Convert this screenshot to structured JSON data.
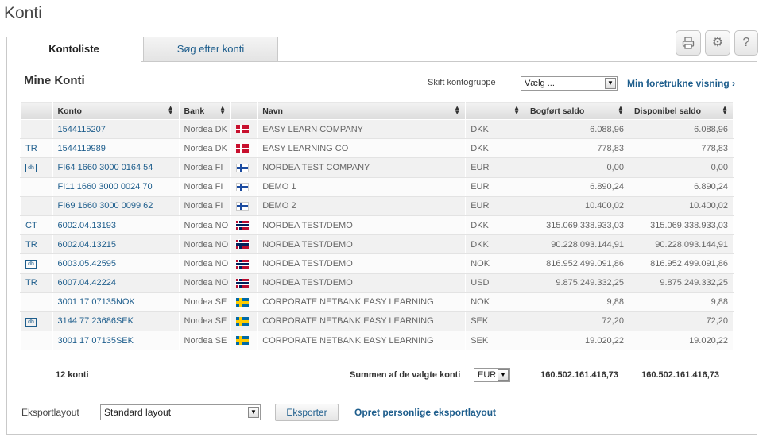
{
  "page": {
    "title": "Konti"
  },
  "tabs": [
    {
      "label": "Kontoliste",
      "active": true
    },
    {
      "label": "Søg efter konti",
      "active": false
    }
  ],
  "toolbar": {
    "icons": [
      "printer-icon",
      "gear-icon",
      "help-icon"
    ],
    "help_label": "?"
  },
  "section": {
    "title": "Mine Konti"
  },
  "group": {
    "label": "Skift kontogruppe",
    "selected": "Vælg ..."
  },
  "favorite_link": "Min foretrukne visning ›",
  "table": {
    "headers": [
      "Konto",
      "Bank",
      "Navn",
      "Bogført saldo",
      "Disponibel saldo"
    ],
    "rows": [
      {
        "type": "",
        "account": "1544115207",
        "bank": "Nordea DK",
        "flag": "dk",
        "name": "EASY LEARN COMPANY",
        "currency": "DKK",
        "booked": "6.088,96",
        "available": "6.088,96"
      },
      {
        "type": "TR",
        "account": "1544119989",
        "bank": "Nordea DK",
        "flag": "dk",
        "name": "EASY LEARNING CO",
        "currency": "DKK",
        "booked": "778,83",
        "available": "778,83"
      },
      {
        "type": "icon",
        "account": "FI64 1660 3000 0164 54",
        "bank": "Nordea FI",
        "flag": "fi",
        "name": "NORDEA TEST COMPANY",
        "currency": "EUR",
        "booked": "0,00",
        "available": "0,00"
      },
      {
        "type": "",
        "account": "FI11 1660 3000 0024 70",
        "bank": "Nordea FI",
        "flag": "fi",
        "name": "DEMO 1",
        "currency": "EUR",
        "booked": "6.890,24",
        "available": "6.890,24"
      },
      {
        "type": "",
        "account": "FI69 1660 3000 0099 62",
        "bank": "Nordea FI",
        "flag": "fi",
        "name": "DEMO 2",
        "currency": "EUR",
        "booked": "10.400,02",
        "available": "10.400,02"
      },
      {
        "type": "CT",
        "account": "6002.04.13193",
        "bank": "Nordea NO",
        "flag": "no",
        "name": "NORDEA TEST/DEMO",
        "currency": "DKK",
        "booked": "315.069.338.933,03",
        "available": "315.069.338.933,03"
      },
      {
        "type": "TR",
        "account": "6002.04.13215",
        "bank": "Nordea NO",
        "flag": "no",
        "name": "NORDEA TEST/DEMO",
        "currency": "DKK",
        "booked": "90.228.093.144,91",
        "available": "90.228.093.144,91"
      },
      {
        "type": "icon",
        "account": "6003.05.42595",
        "bank": "Nordea NO",
        "flag": "no",
        "name": "NORDEA TEST/DEMO",
        "currency": "NOK",
        "booked": "816.952.499.091,86",
        "available": "816.952.499.091,86"
      },
      {
        "type": "TR",
        "account": "6007.04.42224",
        "bank": "Nordea NO",
        "flag": "no",
        "name": "NORDEA TEST/DEMO",
        "currency": "USD",
        "booked": "9.875.249.332,25",
        "available": "9.875.249.332,25"
      },
      {
        "type": "",
        "account": "3001 17 07135NOK",
        "bank": "Nordea SE",
        "flag": "se",
        "name": "CORPORATE NETBANK EASY LEARNING",
        "currency": "NOK",
        "booked": "9,88",
        "available": "9,88"
      },
      {
        "type": "icon",
        "account": "3144 77 23686SEK",
        "bank": "Nordea SE",
        "flag": "se",
        "name": "CORPORATE NETBANK EASY LEARNING",
        "currency": "SEK",
        "booked": "72,20",
        "available": "72,20"
      },
      {
        "type": "",
        "account": "3001 17 07135SEK",
        "bank": "Nordea SE",
        "flag": "se",
        "name": "CORPORATE NETBANK EASY LEARNING",
        "currency": "SEK",
        "booked": "19.020,22",
        "available": "19.020,22"
      }
    ]
  },
  "summary": {
    "count": "12 konti",
    "label": "Summen af de valgte konti",
    "currency": "EUR",
    "booked_total": "160.502.161.416,73",
    "available_total": "160.502.161.416,73"
  },
  "export": {
    "label": "Eksportlayout",
    "selected": "Standard layout",
    "button": "Eksporter",
    "link": "Opret personlige eksportlayout"
  },
  "colors": {
    "link": "#1d5d8c",
    "row_odd": "#f1f1f1",
    "row_even": "#fbfbfb"
  }
}
